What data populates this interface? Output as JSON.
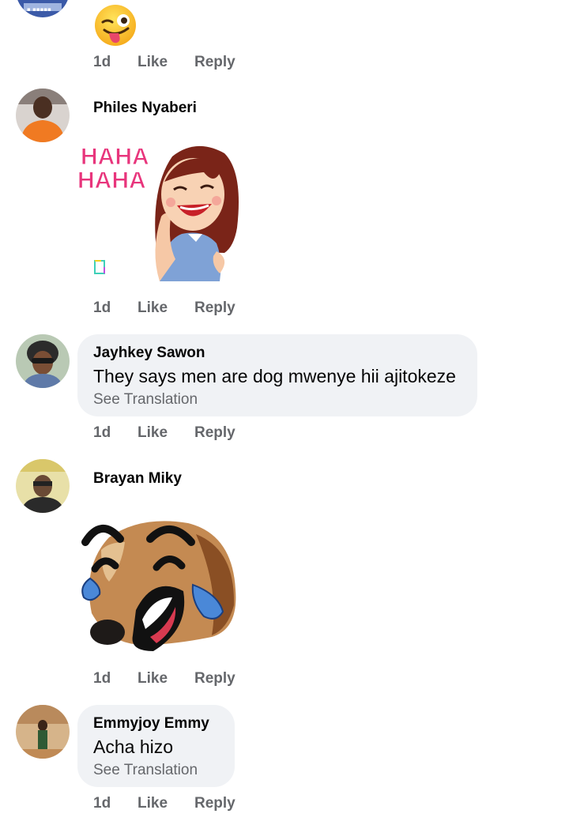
{
  "comments": [
    {
      "time": "1d",
      "like": "Like",
      "reply": "Reply",
      "sticker": "winking-tongue-emoji"
    },
    {
      "author": "Philes Nyaberi",
      "time": "1d",
      "like": "Like",
      "reply": "Reply",
      "sticker_text": "HAHA\nHAHA",
      "sticker_text_line1": "HAHA",
      "sticker_text_line2": "HAHA",
      "sticker": "laughing-girl-sticker"
    },
    {
      "author": "Jayhkey Sawon",
      "text": "They says men are dog mwenye hii ajitokeze",
      "translate": "See Translation",
      "time": "1d",
      "like": "Like",
      "reply": "Reply"
    },
    {
      "author": "Brayan Miky",
      "time": "1d",
      "like": "Like",
      "reply": "Reply",
      "sticker": "crying-laughing-dog-sticker"
    },
    {
      "author": "Emmyjoy Emmy",
      "text": "Acha hizo",
      "translate": "See Translation",
      "time": "1d",
      "like": "Like",
      "reply": "Reply"
    }
  ],
  "colors": {
    "meta": "#65676b",
    "bubble": "#f0f2f5",
    "haha_pink": "#e8357c"
  }
}
